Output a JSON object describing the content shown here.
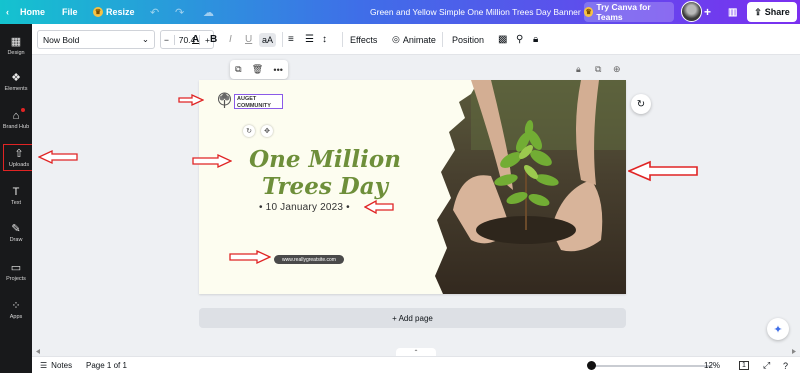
{
  "topbar": {
    "home": "Home",
    "file": "File",
    "resize": "Resize",
    "doc_title": "Green and Yellow Simple One Million Trees Day Banner",
    "try_teams": "Try Canva for Teams",
    "share": "Share"
  },
  "rail": [
    {
      "label": "Design",
      "icon": "design-icon"
    },
    {
      "label": "Elements",
      "icon": "elements-icon"
    },
    {
      "label": "Brand Hub",
      "icon": "brand-hub-icon"
    },
    {
      "label": "Uploads",
      "icon": "uploads-icon"
    },
    {
      "label": "Text",
      "icon": "text-icon"
    },
    {
      "label": "Draw",
      "icon": "draw-icon"
    },
    {
      "label": "Projects",
      "icon": "projects-icon"
    },
    {
      "label": "Apps",
      "icon": "apps-icon"
    }
  ],
  "toolbar": {
    "font": "Now Bold",
    "size_minus": "−",
    "font_size": "70.4",
    "size_plus": "+",
    "bold": "B",
    "italic": "I",
    "underline": "U",
    "case": "aA",
    "effects": "Effects",
    "animate": "Animate",
    "position": "Position"
  },
  "design": {
    "logo_text": "AUGET COMMUNITY",
    "title_line1": "One Million",
    "title_line2": "Trees Day",
    "date": "• 10 January 2023 •",
    "url": "www.reallygreatsite.com"
  },
  "canvas": {
    "add_page": "+ Add page"
  },
  "bottombar": {
    "notes": "Notes",
    "page_info": "Page 1 of 1",
    "zoom": "12%",
    "page_count": "1"
  },
  "colors": {
    "annotation_arrow": "#e02424",
    "title_green": "#6e8f3a",
    "rail_bg": "#18191b"
  }
}
